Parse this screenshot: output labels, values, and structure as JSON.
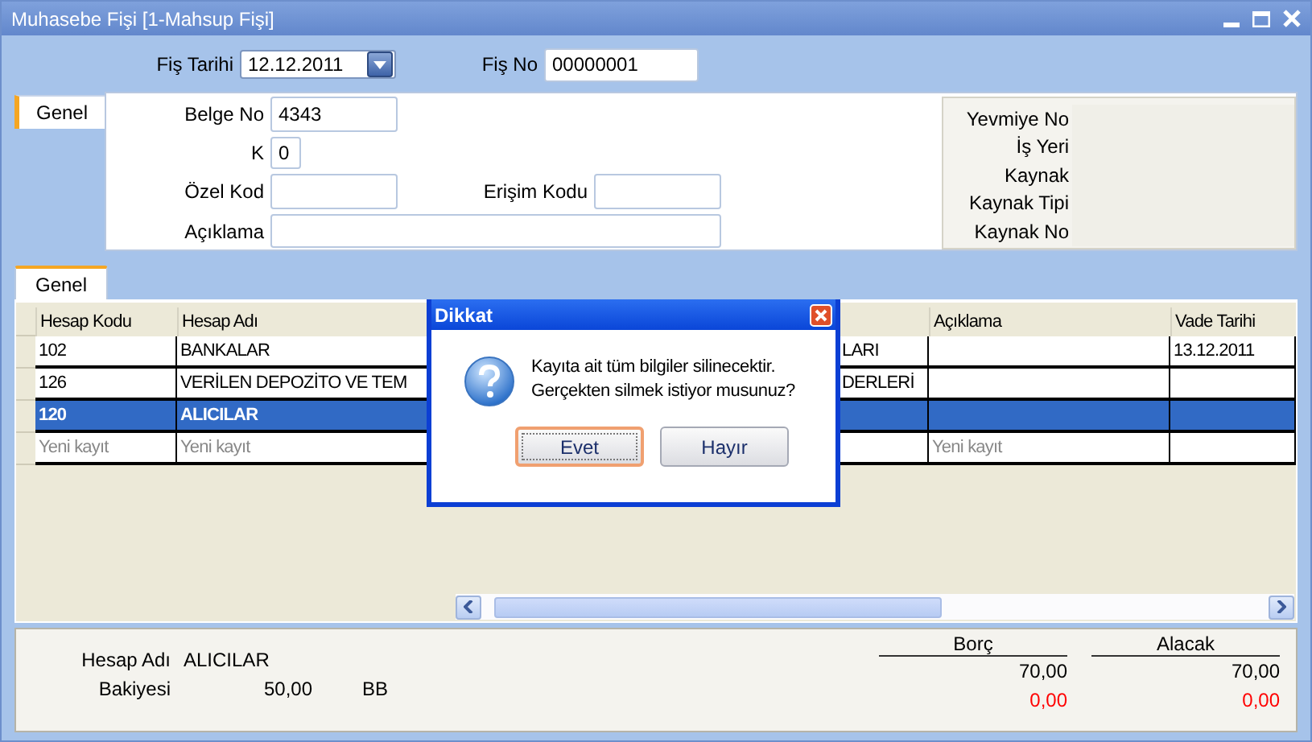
{
  "window": {
    "title": "Muhasebe Fişi  [1-Mahsup Fişi]"
  },
  "header_fields": [
    {
      "label": "Fiş Tarihi",
      "value": "12.12.2011",
      "kind": "date"
    },
    {
      "label": "Fiş No",
      "value": "00000001",
      "kind": "text"
    }
  ],
  "form_tabs": [
    {
      "label": "Genel",
      "selected": true
    }
  ],
  "form_rows": [
    [
      {
        "label": "Belge No",
        "value": "4343",
        "kind": "medium"
      }
    ],
    [
      {
        "label": "K",
        "value": "0",
        "kind": "short"
      }
    ],
    [
      {
        "label": "Özel Kod",
        "kind": "medium"
      },
      {
        "label": "Erişim Kodu",
        "kind": "medium"
      }
    ],
    [
      {
        "label": "Açıklama",
        "kind": "wide"
      }
    ]
  ],
  "info_labels": [
    "Yevmiye No",
    "İş Yeri",
    "Kaynak",
    "Kaynak Tipi",
    "Kaynak No"
  ],
  "grid_tabs": [
    {
      "label": "Genel",
      "selected": true
    }
  ],
  "grid": {
    "columns": [
      "Hesap Kodu",
      "Hesap Adı",
      "",
      "Açıklama",
      "Vade Tarihi"
    ],
    "rows": [
      {
        "kind": "data",
        "selected": false,
        "cells": [
          "102",
          "BANKALAR",
          "LARI",
          "",
          "13.12.2011"
        ]
      },
      {
        "kind": "data",
        "selected": false,
        "cells": [
          "126",
          "VERİLEN DEPOZİTO VE TEM",
          "DERLERİ",
          "",
          ""
        ]
      },
      {
        "kind": "data",
        "selected": true,
        "cells": [
          "120",
          "ALICILAR",
          "",
          "",
          ""
        ]
      },
      {
        "kind": "new",
        "selected": false,
        "cells": [
          "Yeni kayıt",
          "Yeni kayıt",
          "",
          "Yeni kayıt",
          ""
        ]
      }
    ]
  },
  "summary": {
    "account_label": "Hesap Adı",
    "account_value": "ALICILAR",
    "balance_label": "Bakiyesi",
    "balance_value": "50,00",
    "balance_side": "BB"
  },
  "totals": {
    "columns": [
      "Borç",
      "Alacak"
    ],
    "rows": [
      {
        "kind": "total",
        "values": [
          "70,00",
          "70,00"
        ]
      },
      {
        "kind": "difference",
        "values": [
          "0,00",
          "0,00"
        ]
      }
    ]
  },
  "dialog": {
    "title": "Dikkat",
    "message": "Kayıta ait tüm bilgiler silinecektir.\nGerçekten silmek istiyor musunuz?",
    "buttons": [
      {
        "label": "Evet",
        "focused": true
      },
      {
        "label": "Hayır",
        "focused": false
      }
    ]
  }
}
